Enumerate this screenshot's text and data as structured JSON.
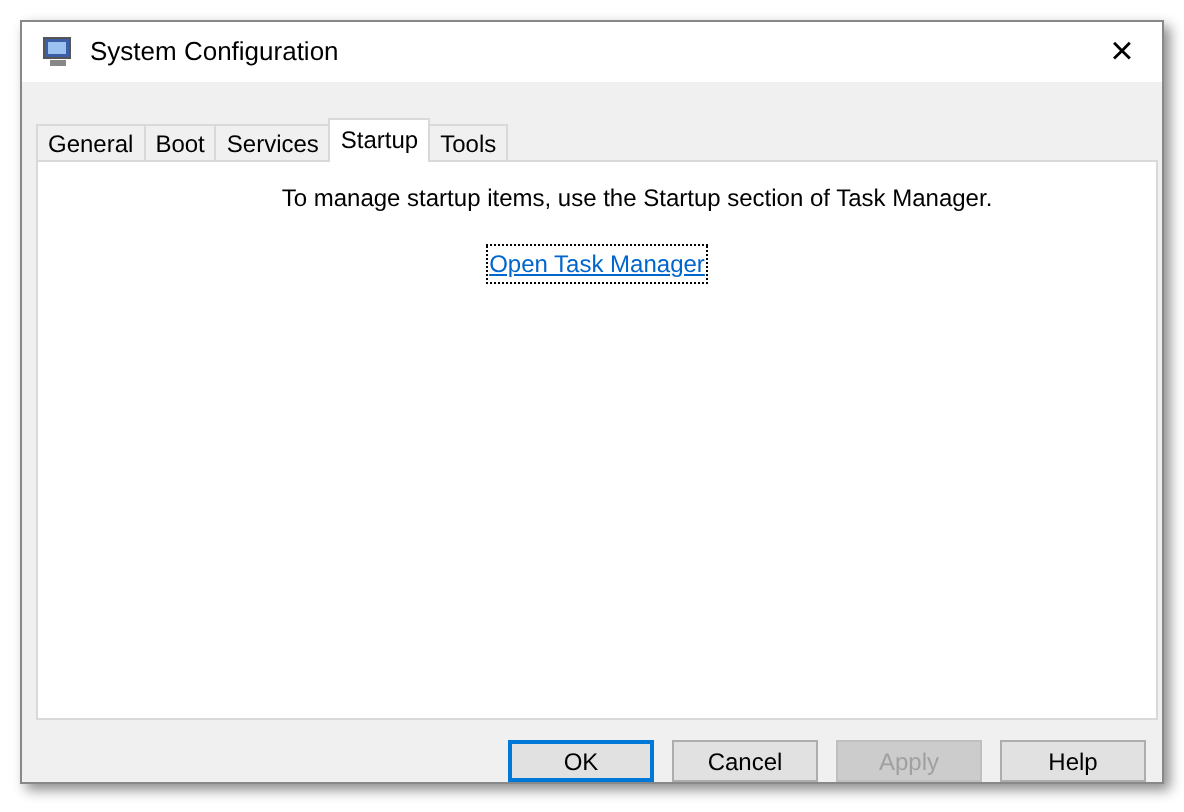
{
  "window": {
    "title": "System Configuration",
    "close": "×"
  },
  "tabs": [
    {
      "label": "General",
      "selected": false
    },
    {
      "label": "Boot",
      "selected": false
    },
    {
      "label": "Services",
      "selected": false
    },
    {
      "label": "Startup",
      "selected": true
    },
    {
      "label": "Tools",
      "selected": false
    }
  ],
  "panel": {
    "message": "To manage startup items, use the Startup section of Task Manager.",
    "link": "Open Task Manager"
  },
  "buttons": [
    {
      "label": "OK",
      "default": true,
      "disabled": false
    },
    {
      "label": "Cancel",
      "default": false,
      "disabled": false
    },
    {
      "label": "Apply",
      "default": false,
      "disabled": true
    },
    {
      "label": "Help",
      "default": false,
      "disabled": false
    }
  ]
}
